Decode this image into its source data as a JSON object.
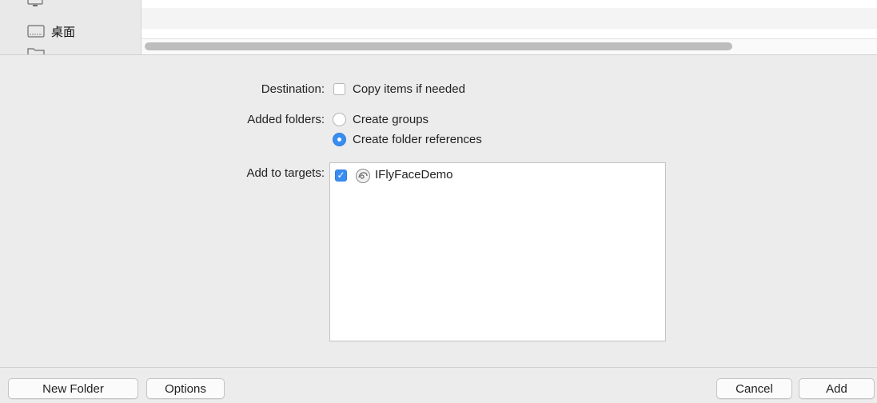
{
  "sidebar": {
    "items": [
      {
        "label": "",
        "icon": "computer-icon"
      },
      {
        "label": "桌面",
        "icon": "desktop-folder-icon"
      },
      {
        "label": "",
        "icon": "folder-icon"
      }
    ]
  },
  "form": {
    "destination_label": "Destination:",
    "copy_items_label": "Copy items if needed",
    "copy_items_checked": false,
    "added_folders_label": "Added folders:",
    "folder_options": [
      {
        "label": "Create groups",
        "selected": false
      },
      {
        "label": "Create folder references",
        "selected": true
      }
    ],
    "add_to_targets_label": "Add to targets:",
    "targets": [
      {
        "name": "IFlyFaceDemo",
        "checked": true,
        "icon": "app-target-icon"
      }
    ]
  },
  "buttons": {
    "new_folder": "New Folder",
    "options": "Options",
    "cancel": "Cancel",
    "add": "Add"
  },
  "colors": {
    "accent": "#3a8df0",
    "window_bg": "#ececec"
  }
}
